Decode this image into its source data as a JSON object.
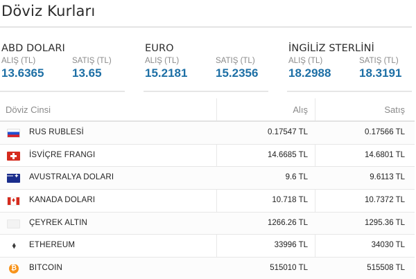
{
  "page": {
    "title": "Döviz Kurları"
  },
  "cards": [
    {
      "name": "ABD DOLARI",
      "buy_label": "ALIŞ (TL)",
      "buy": "13.6365",
      "sell_label": "SATIŞ (TL)",
      "sell": "13.65"
    },
    {
      "name": "EURO",
      "buy_label": "ALIŞ (TL)",
      "buy": "15.2181",
      "sell_label": "SATIŞ (TL)",
      "sell": "15.2356"
    },
    {
      "name": "İNGİLİZ STERLİNİ",
      "buy_label": "ALIŞ (TL)",
      "buy": "18.2988",
      "sell_label": "SATIŞ (TL)",
      "sell": "18.3191"
    }
  ],
  "table": {
    "headers": {
      "name": "Döviz Cinsi",
      "buy": "Alış",
      "sell": "Satış"
    },
    "rows": [
      {
        "name": "RUS RUBLESİ",
        "buy": "0.17547 TL",
        "sell": "0.17566 TL",
        "icon": "russia-flag-icon"
      },
      {
        "name": "İSVİÇRE FRANGI",
        "buy": "14.6685 TL",
        "sell": "14.6801 TL",
        "icon": "switzerland-flag-icon"
      },
      {
        "name": "AVUSTRALYA DOLARI",
        "buy": "9.6 TL",
        "sell": "9.6113 TL",
        "icon": "australia-flag-icon"
      },
      {
        "name": "KANADA DOLARI",
        "buy": "10.718 TL",
        "sell": "10.7372 TL",
        "icon": "canada-flag-icon"
      },
      {
        "name": "ÇEYREK ALTIN",
        "buy": "1266.26 TL",
        "sell": "1295.36 TL",
        "icon": "gold-icon"
      },
      {
        "name": "ETHEREUM",
        "buy": "33996 TL",
        "sell": "34030 TL",
        "icon": "ethereum-icon"
      },
      {
        "name": "BITCOIN",
        "buy": "515010 TL",
        "sell": "515508 TL",
        "icon": "bitcoin-icon"
      }
    ]
  },
  "colors": {
    "accent": "#1d6fa5",
    "muted": "#8a8a8a",
    "rule": "#e6e6e6"
  }
}
